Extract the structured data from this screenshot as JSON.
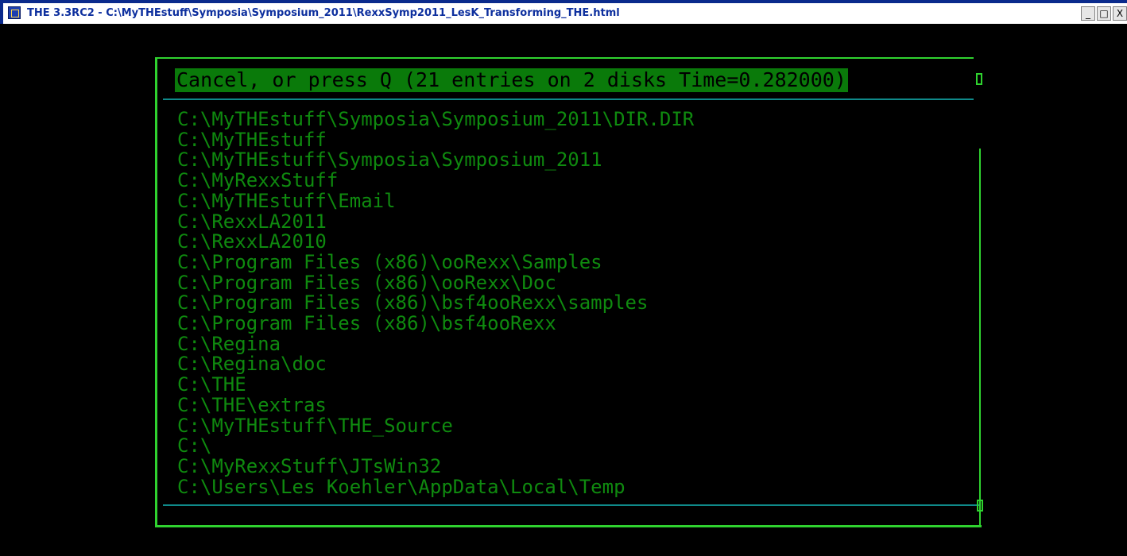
{
  "window": {
    "title": "THE 3.3RC2 - C:\\MyTHEstuff\\Symposia\\Symposium_2011\\RexxSymp2011_LesK_Transforming_THE.html",
    "controls": {
      "minimize": "_",
      "maximize": "□",
      "close": "X"
    }
  },
  "dialog": {
    "header": "Cancel, or press Q (21 entries on 2 disks Time=0.282000)",
    "entries": [
      "C:\\MyTHEstuff\\Symposia\\Symposium_2011\\DIR.DIR",
      "C:\\MyTHEstuff",
      "C:\\MyTHEstuff\\Symposia\\Symposium_2011",
      "C:\\MyRexxStuff",
      "C:\\MyTHEstuff\\Email",
      "C:\\RexxLA2011",
      "C:\\RexxLA2010",
      "C:\\Program Files (x86)\\ooRexx\\Samples",
      "C:\\Program Files (x86)\\ooRexx\\Doc",
      "C:\\Program Files (x86)\\bsf4ooRexx\\samples",
      "C:\\Program Files (x86)\\bsf4ooRexx",
      "C:\\Regina",
      "C:\\Regina\\doc",
      "C:\\THE",
      "C:\\THE\\extras",
      "C:\\MyTHEstuff\\THE_Source",
      "C:\\",
      "C:\\MyRexxStuff\\JTsWin32",
      "C:\\Users\\Les Koehler\\AppData\\Local\\Temp"
    ]
  },
  "colors": {
    "background": "#000000",
    "text_green": "#0f8a0f",
    "header_bg": "#0a7a0a",
    "frame_green": "#2fd22f",
    "separator_teal": "#0f8a8a",
    "title_blue": "#0d2f9e"
  },
  "icons": {
    "app": "the-editor-icon"
  }
}
